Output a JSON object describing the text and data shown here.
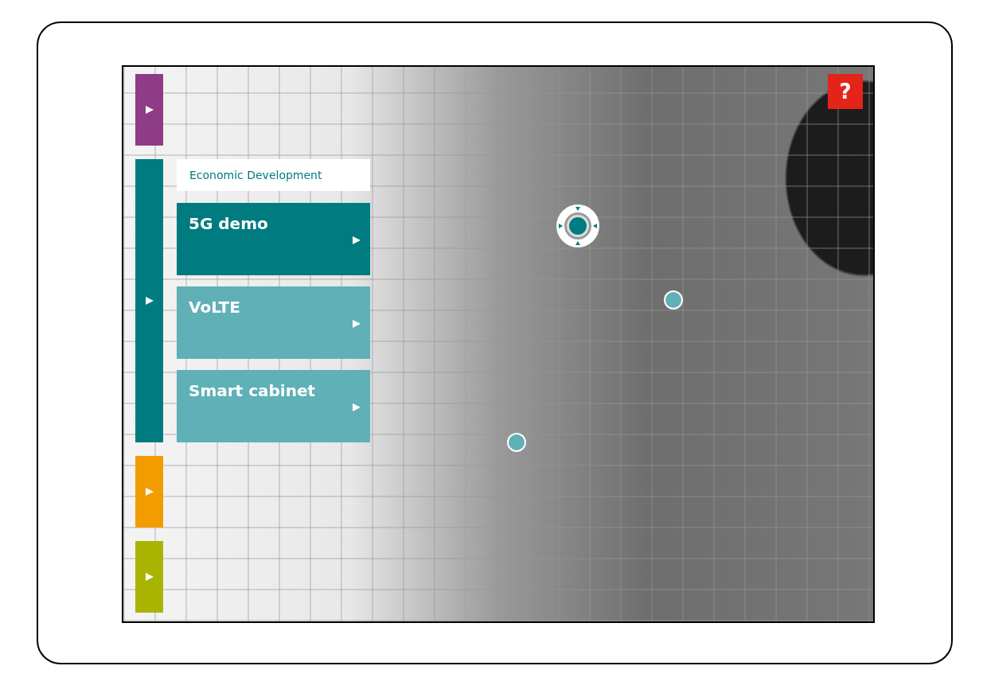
{
  "side_tabs": [
    {
      "color": "#8e3c86",
      "expanded": false
    },
    {
      "color": "#007c80",
      "expanded": true
    },
    {
      "color": "#f39c00",
      "expanded": false
    },
    {
      "color": "#a8b400",
      "expanded": false
    }
  ],
  "panel": {
    "title": "Economic Development",
    "items": [
      {
        "label": "5G demo",
        "selected": true
      },
      {
        "label": "VoLTE",
        "selected": false
      },
      {
        "label": "Smart cabinet",
        "selected": false
      }
    ]
  },
  "map_markers": [
    {
      "selected": true
    },
    {
      "selected": false
    },
    {
      "selected": false
    }
  ],
  "help_button": {
    "label": "?"
  }
}
